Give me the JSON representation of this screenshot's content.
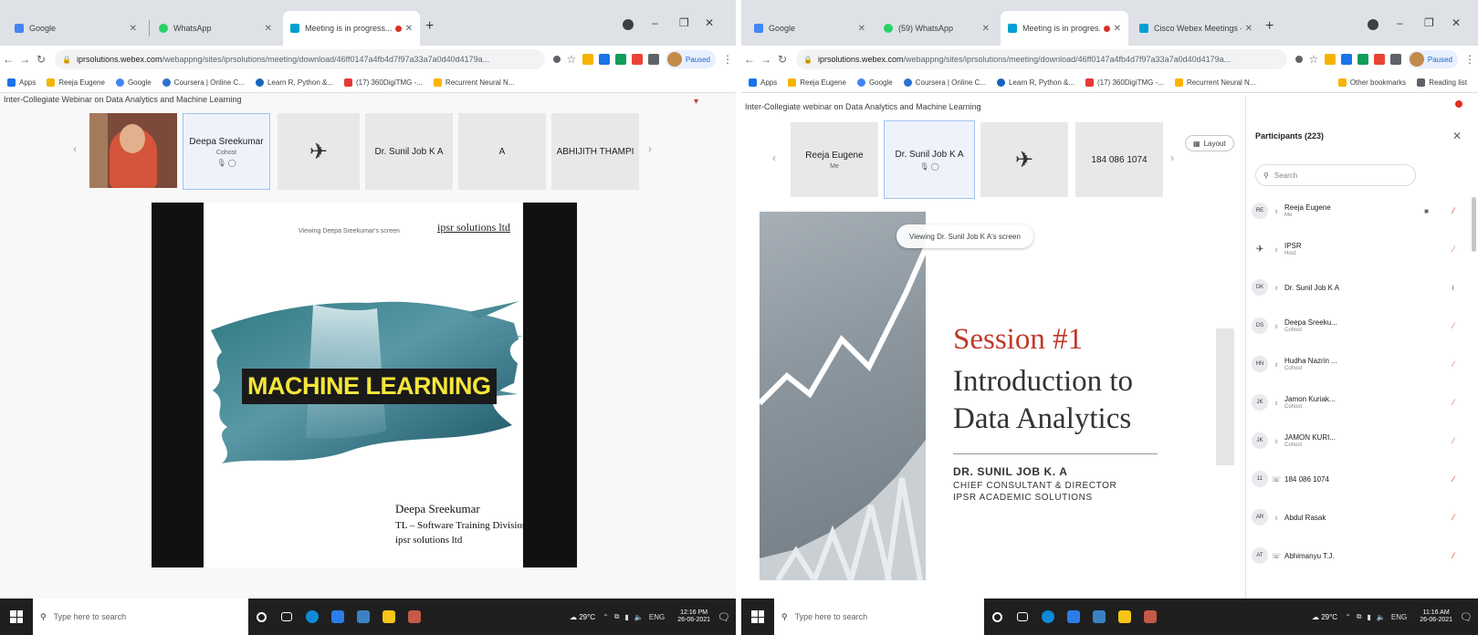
{
  "left": {
    "tabs": [
      {
        "title": "Google",
        "active": false,
        "color": "#4285f4"
      },
      {
        "title": "WhatsApp",
        "active": false,
        "color": "#25d366"
      },
      {
        "title": "Meeting is in progress...",
        "active": true,
        "color": "#00a0d1"
      }
    ],
    "url_host": "iprsolutions.webex.com",
    "url_path": "/webappng/sites/iprsolutions/meeting/download/46ff0147a4fb4d7f97a33a7a0d40d4179a...",
    "paused_label": "Paused",
    "bookmarks": [
      "Apps",
      "Reeja Eugene",
      "Google",
      "Coursera | Online C...",
      "Learn R, Python &...",
      "(17) 360DigiTMG -...",
      "Recurrent Neural N..."
    ],
    "meeting_title": "Inter-Collegiate Webinar on Data Analytics and Machine Learning",
    "strip": [
      {
        "name": "Deepa Sreekumar",
        "role": "Cohost",
        "selected": true
      },
      {
        "name": "",
        "role": "",
        "logo": true
      },
      {
        "name": "Dr. Sunil Job K A",
        "role": ""
      },
      {
        "name": "A",
        "role": ""
      },
      {
        "name": "ABHIJITH THAMPI",
        "role": ""
      }
    ],
    "viewing_text": "Viewing Deepa Sreekumar's screen",
    "brand": "ipsr solutions ltd",
    "slide_title": "MACHINE LEARNING",
    "author_name": "Deepa Sreekumar",
    "author_role": "TL – Software Training Division",
    "author_org": "ipsr solutions ltd",
    "clock_time": "12:16 PM",
    "clock_date": "26-06-2021"
  },
  "right": {
    "tabs": [
      {
        "title": "Google",
        "active": false,
        "color": "#4285f4"
      },
      {
        "title": "(59) WhatsApp",
        "active": false,
        "color": "#25d366"
      },
      {
        "title": "Meeting is in progres...",
        "active": true,
        "color": "#00a0d1"
      },
      {
        "title": "Cisco Webex Meetings - Home",
        "active": false,
        "color": "#00a0d1"
      }
    ],
    "url_host": "iprsolutions.webex.com",
    "url_path": "/webappng/sites/iprsolutions/meeting/download/46ff0147a4fb4d7f97a33a7a0d40d4179a...",
    "paused_label": "Paused",
    "bookmarks": [
      "Apps",
      "Reeja Eugene",
      "Google",
      "Coursera | Online C...",
      "Learn R, Python &...",
      "(17) 360DigiTMG -...",
      "Recurrent Neural N..."
    ],
    "other_bookmarks": "Other bookmarks",
    "reading_list": "Reading list",
    "meeting_title": "Inter-Collegiate webinar on Data Analytics and Machine Learning",
    "strip": [
      {
        "name": "Reeja Eugene",
        "role": "Me",
        "selected": false
      },
      {
        "name": "Dr. Sunil Job K A",
        "role": "",
        "selected": true
      },
      {
        "name": "",
        "role": "",
        "logo": true
      },
      {
        "name": "184 086 1074",
        "role": ""
      }
    ],
    "layout_label": "Layout",
    "viewing_text": "Viewing Dr. Sunil Job K A's screen",
    "session": "Session #1",
    "intro_line1": "Introduction to",
    "intro_line2": "Data Analytics",
    "presenter_name": "DR. SUNIL JOB K. A",
    "presenter_title": "CHIEF CONSULTANT & DIRECTOR",
    "presenter_org": "IPSR ACADEMIC SOLUTIONS",
    "participants_header": "Participants (223)",
    "search_placeholder": "Search",
    "participants": [
      {
        "initials": "RE",
        "name": "Reeja Eugene",
        "role": "Me"
      },
      {
        "initials": "IP",
        "name": "IPSR",
        "role": "Host"
      },
      {
        "initials": "DK",
        "name": "Dr. Sunil Job K A",
        "role": ""
      },
      {
        "initials": "DS",
        "name": "Deepa Sreeku...",
        "role": "Cohost"
      },
      {
        "initials": "HN",
        "name": "Hudha Nazrin ...",
        "role": "Cohost"
      },
      {
        "initials": "JK",
        "name": "Jamon Kuriak...",
        "role": "Cohost"
      },
      {
        "initials": "JK",
        "name": "JAMON KURI...",
        "role": "Cohost"
      },
      {
        "initials": "11",
        "name": "184 086 1074",
        "role": ""
      },
      {
        "initials": "AR",
        "name": "Abdul Rasak",
        "role": ""
      },
      {
        "initials": "AT",
        "name": "Abhimanyu T.J.",
        "role": ""
      }
    ],
    "clock_time": "11:16 AM",
    "clock_date": "26-06-2021"
  },
  "taskbar": {
    "search_placeholder": "Type here to search",
    "weather": "29°C",
    "lang": "ENG"
  }
}
